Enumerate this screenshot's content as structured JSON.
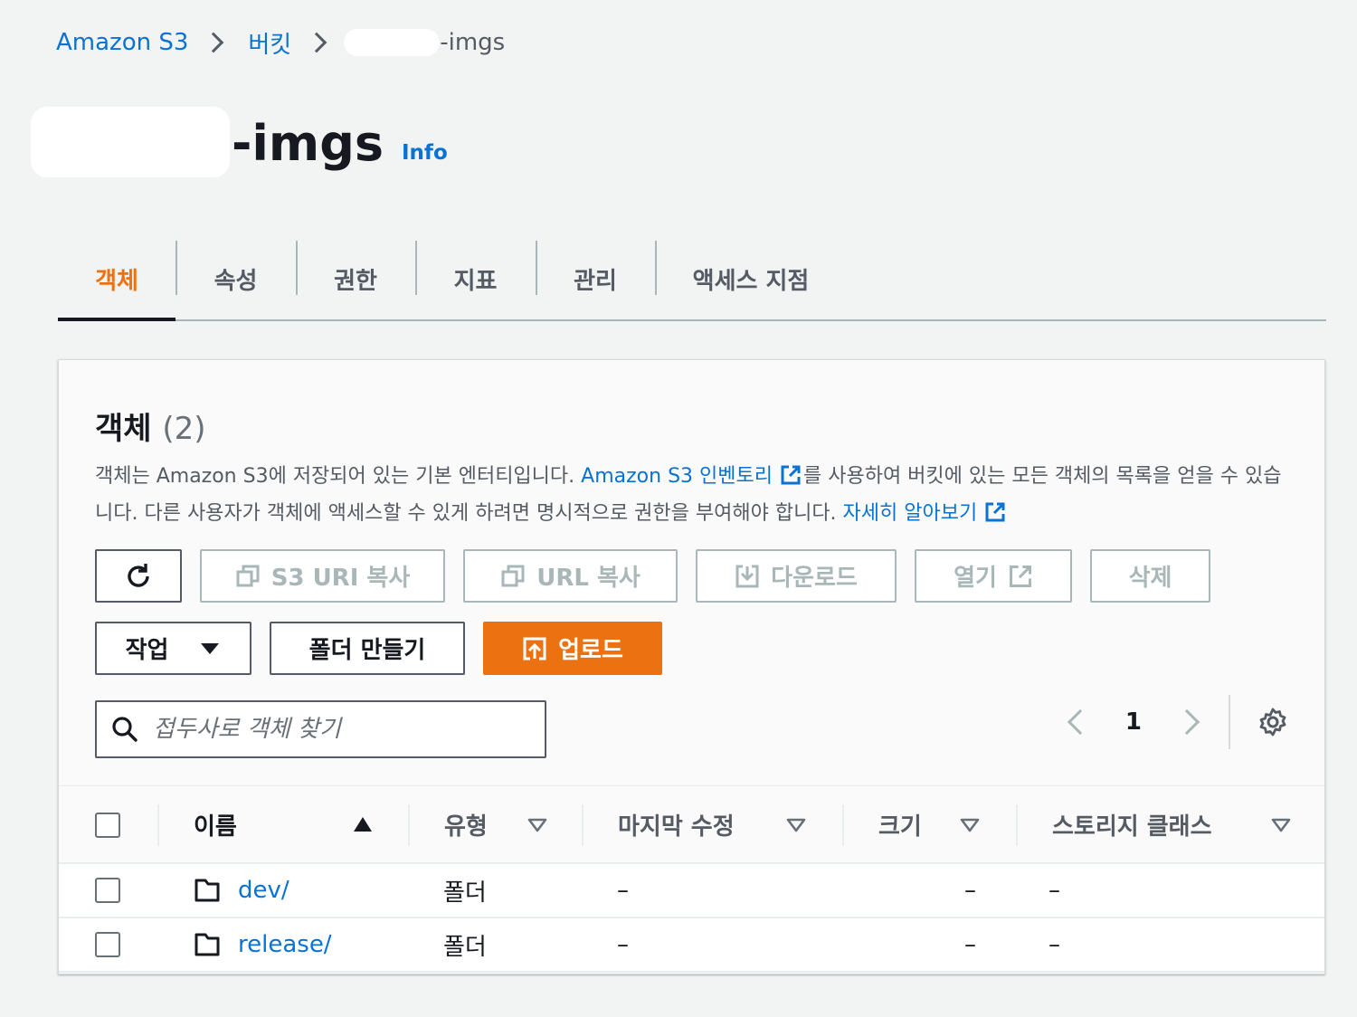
{
  "breadcrumb": {
    "root": "Amazon S3",
    "buckets": "버킷",
    "current_suffix": "-imgs"
  },
  "header": {
    "title_suffix": "-imgs",
    "info_label": "Info"
  },
  "tabs": [
    {
      "label": "객체",
      "active": true
    },
    {
      "label": "속성",
      "active": false
    },
    {
      "label": "권한",
      "active": false
    },
    {
      "label": "지표",
      "active": false
    },
    {
      "label": "관리",
      "active": false
    },
    {
      "label": "액세스 지점",
      "active": false
    }
  ],
  "objects_panel": {
    "title": "객체",
    "count": "(2)",
    "desc_part1": "객체는 Amazon S3에 저장되어 있는 기본 엔터티입니다. ",
    "inventory_link": "Amazon S3 인벤토리",
    "desc_part2": "를 사용하여 버킷에 있는 모든 객체의 목록을 얻을 수 있습니다. 다른 사용자가 객체에 액세스할 수 있게 하려면 명시적으로 권한을 부여해야 합니다. ",
    "learn_more_link": "자세히 알아보기"
  },
  "toolbar": {
    "refresh_icon": "refresh-icon",
    "copy_s3_uri": "S3 URI 복사",
    "copy_url": "URL 복사",
    "download": "다운로드",
    "open": "열기",
    "delete": "삭제",
    "actions": "작업",
    "create_folder": "폴더 만들기",
    "upload": "업로드"
  },
  "search": {
    "placeholder": "접두사로 객체 찾기"
  },
  "pagination": {
    "current_page": "1"
  },
  "table": {
    "columns": [
      "이름",
      "유형",
      "마지막 수정",
      "크기",
      "스토리지 클래스"
    ],
    "rows": [
      {
        "name": "dev/",
        "type": "폴더",
        "last_modified": "–",
        "size": "–",
        "storage_class": "–"
      },
      {
        "name": "release/",
        "type": "폴더",
        "last_modified": "–",
        "size": "–",
        "storage_class": "–"
      }
    ]
  },
  "colors": {
    "accent": "#ec7211",
    "link": "#0972d3",
    "background": "#f2f3f3"
  }
}
